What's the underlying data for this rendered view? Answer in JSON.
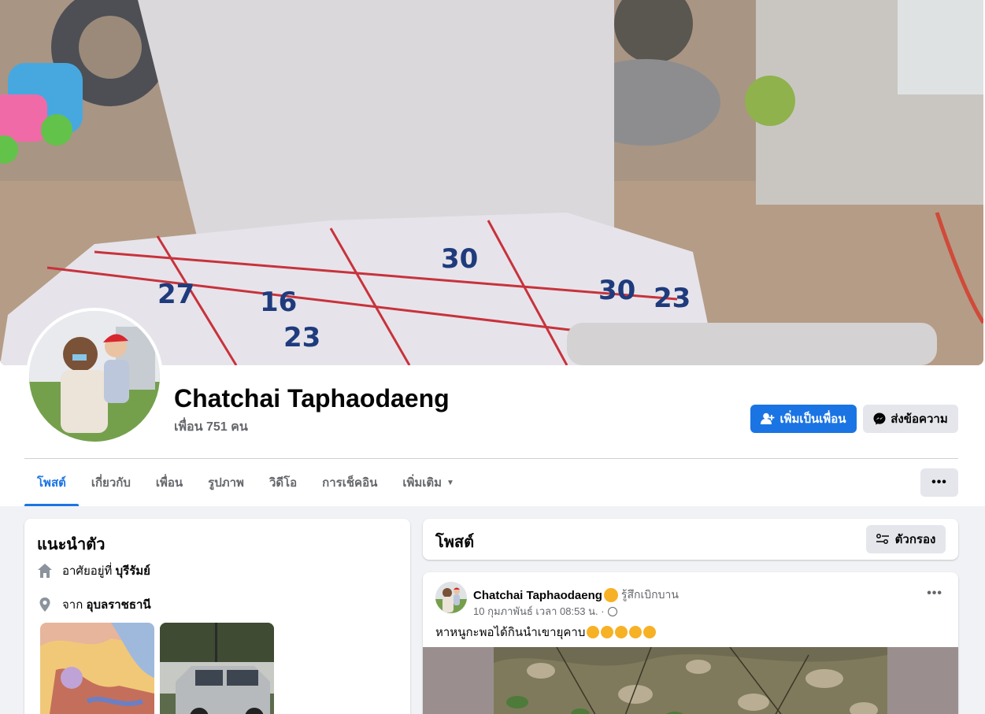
{
  "profile": {
    "name": "Chatchai Taphaodaeng",
    "friends": "เพื่อน 751 คน"
  },
  "actions": {
    "add_friend": "เพิ่มเป็นเพื่อน",
    "message": "ส่งข้อความ",
    "more": "•••"
  },
  "tabs": [
    {
      "label": "โพสต์",
      "active": true
    },
    {
      "label": "เกี่ยวกับ"
    },
    {
      "label": "เพื่อน"
    },
    {
      "label": "รูปภาพ"
    },
    {
      "label": "วิดีโอ"
    },
    {
      "label": "การเช็คอิน"
    },
    {
      "label": "เพิ่มเติม"
    }
  ],
  "intro": {
    "title": "แนะนำตัว",
    "lives_prefix": "อาศัยอยู่ที่",
    "lives_city": "บุรีรัมย์",
    "from_prefix": "จาก",
    "from_city": "อุบลราชธานี"
  },
  "posts_section": {
    "title": "โพสต์",
    "filter_label": "ตัวกรอง"
  },
  "post": {
    "author": "Chatchai Taphaodaeng",
    "feeling": "รู้สึกเบิกบาน",
    "timestamp": "10 กุมภาพันธ์ เวลา 08:53 น. ·",
    "text": "หาหนูกะพอได้กินนำเขายุคาบ",
    "more": "•••"
  },
  "colors": {
    "accent": "#1b74e4",
    "secondary_text": "#65676b",
    "background": "#f0f2f5"
  }
}
